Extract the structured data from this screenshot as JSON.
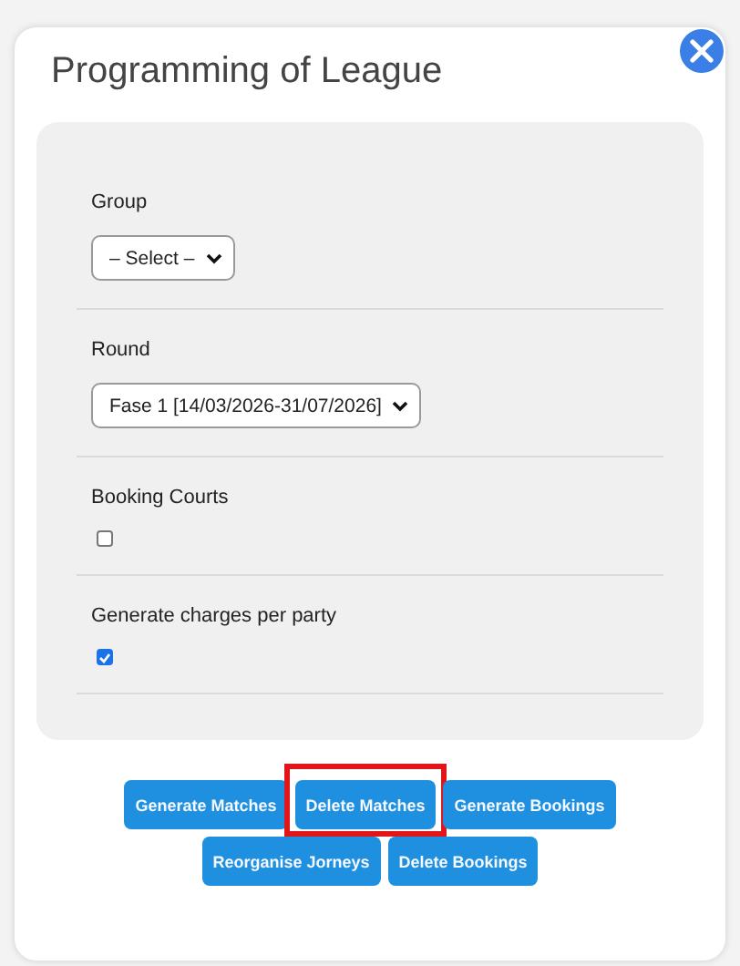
{
  "dialog": {
    "title": "Programming of League"
  },
  "fields": [
    {
      "kind": "select",
      "label": "Group",
      "value": "– Select –"
    },
    {
      "kind": "select",
      "label": "Round",
      "value": "Fase 1 [14/03/2026-31/07/2026]"
    },
    {
      "kind": "checkbox",
      "label": "Booking Courts",
      "checked": false
    },
    {
      "kind": "checkbox",
      "label": "Generate charges per party",
      "checked": true
    }
  ],
  "buttons": [
    [
      {
        "label": "Generate Matches",
        "highlighted": false
      },
      {
        "label": "Delete Matches",
        "highlighted": true
      },
      {
        "label": "Generate Bookings",
        "highlighted": false
      }
    ],
    [
      {
        "label": "Reorganise Jorneys",
        "highlighted": false
      },
      {
        "label": "Delete Bookings",
        "highlighted": false
      }
    ]
  ]
}
